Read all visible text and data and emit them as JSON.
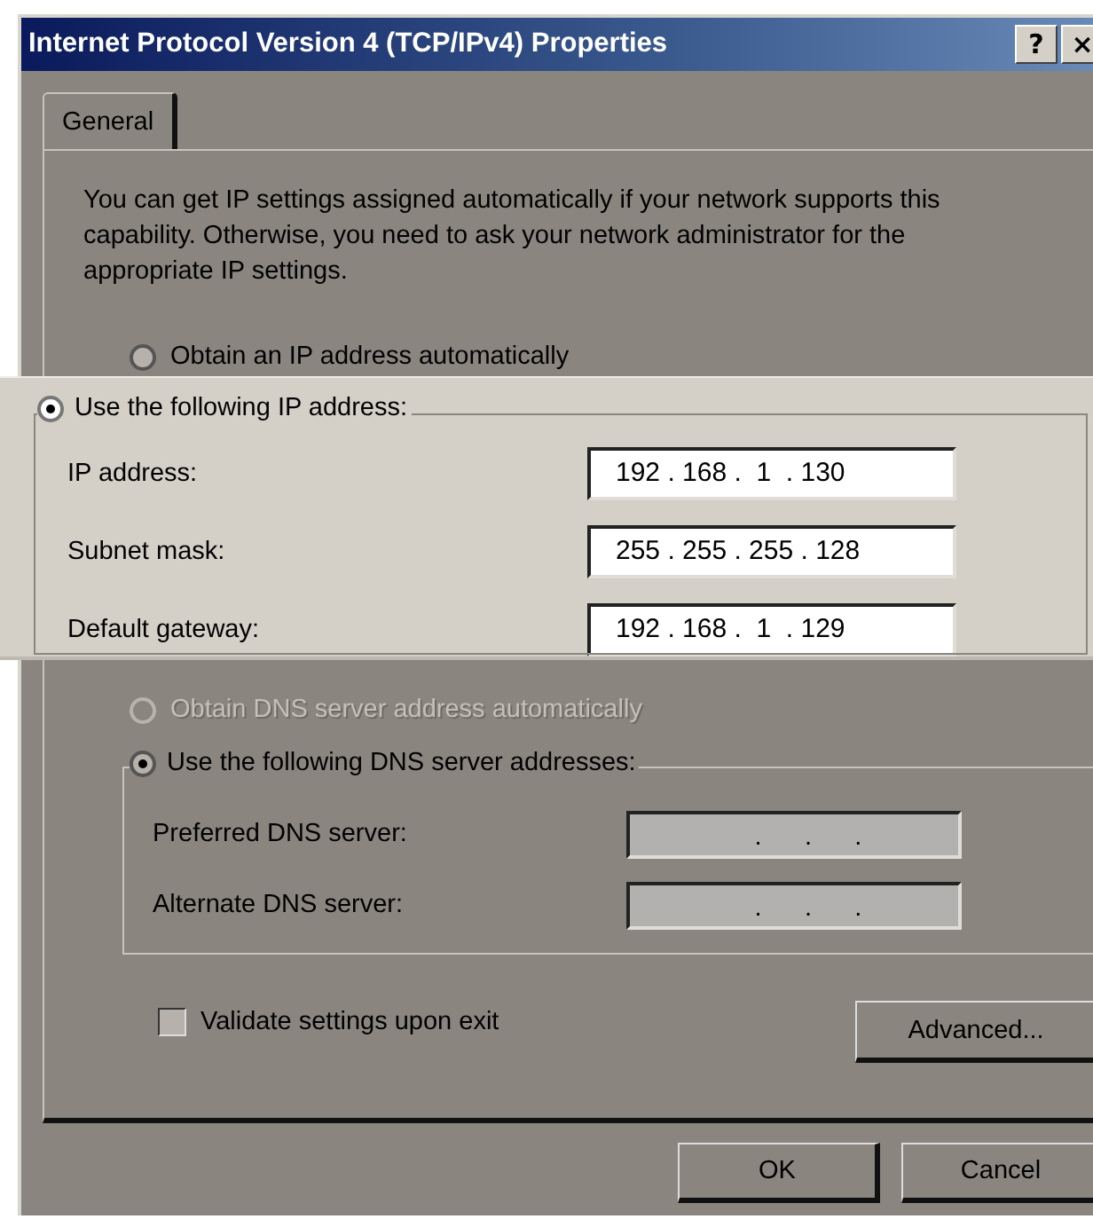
{
  "window": {
    "title": "Internet Protocol Version 4 (TCP/IPv4) Properties",
    "title_buttons": [
      "?",
      "×"
    ]
  },
  "tabs": [
    {
      "label": "General",
      "selected": true
    }
  ],
  "description": "You can get IP settings assigned automatically if your network supports this capability. Otherwise, you need to ask your network administrator for the appropriate IP settings.",
  "ip_options": [
    {
      "label": "Obtain an IP address automatically",
      "selected": false,
      "disabled": false
    },
    {
      "label": "Use the following IP address:",
      "selected": true,
      "disabled": false
    }
  ],
  "ip_fields": [
    {
      "label": "IP address:",
      "value": "192 . 168 .  1  . 130",
      "disabled": false
    },
    {
      "label": "Subnet mask:",
      "value": "255 . 255 . 255 . 128",
      "disabled": false
    },
    {
      "label": "Default gateway:",
      "value": "192 . 168 .  1  . 129",
      "disabled": false
    }
  ],
  "dns_options": [
    {
      "label": "Obtain DNS server address automatically",
      "selected": false,
      "disabled": true
    },
    {
      "label": "Use the following DNS server addresses:",
      "selected": true,
      "disabled": false
    }
  ],
  "dns_fields": [
    {
      "label": "Preferred DNS server:",
      "value": ".      .      .",
      "disabled": true
    },
    {
      "label": "Alternate DNS server:",
      "value": ".      .      .",
      "disabled": true
    }
  ],
  "validate": {
    "label": "Validate settings upon exit",
    "checked": false
  },
  "advanced_button": "Advanced...",
  "buttons": [
    "OK",
    "Cancel"
  ]
}
